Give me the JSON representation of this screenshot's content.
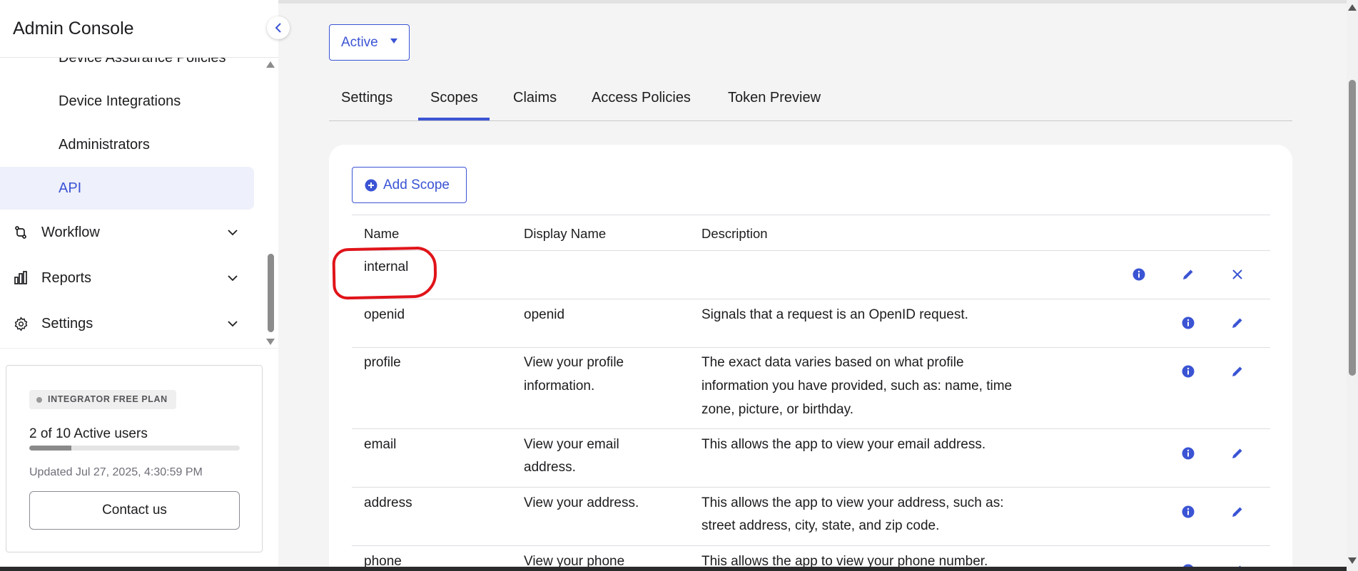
{
  "app": {
    "title": "Admin Console"
  },
  "sidebar": {
    "sub_items": [
      {
        "label": "Device Assurance Policies",
        "active": false
      },
      {
        "label": "Device Integrations",
        "active": false
      },
      {
        "label": "Administrators",
        "active": false
      },
      {
        "label": "API",
        "active": true
      }
    ],
    "groups": [
      {
        "label": "Workflow",
        "icon": "workflow-icon"
      },
      {
        "label": "Reports",
        "icon": "reports-icon"
      },
      {
        "label": "Settings",
        "icon": "settings-gear-icon"
      }
    ]
  },
  "plan": {
    "badge": "INTEGRATOR FREE PLAN",
    "users_text": "2 of 10 Active users",
    "users_used": 2,
    "users_total": 10,
    "updated": "Updated Jul 27, 2025, 4:30:59 PM",
    "contact_label": "Contact us"
  },
  "main": {
    "status": "Active",
    "tabs": [
      {
        "label": "Settings",
        "active": false
      },
      {
        "label": "Scopes",
        "active": true
      },
      {
        "label": "Claims",
        "active": false
      },
      {
        "label": "Access Policies",
        "active": false
      },
      {
        "label": "Token Preview",
        "active": false
      }
    ],
    "add_scope_label": "Add Scope",
    "columns": {
      "name": "Name",
      "display_name": "Display Name",
      "description": "Description"
    },
    "rows": [
      {
        "name": "internal",
        "display_name": "",
        "description": [],
        "actions": [
          "info",
          "edit",
          "delete"
        ]
      },
      {
        "name": "openid",
        "display_name": "openid",
        "description": [
          "Signals that a request is an OpenID request."
        ],
        "actions": [
          "info",
          "edit"
        ]
      },
      {
        "name": "profile",
        "display_name": [
          "View your profile",
          "information."
        ],
        "description": [
          "The exact data varies based on what profile",
          "information you have provided, such as: name, time",
          "zone, picture, or birthday."
        ],
        "actions": [
          "info",
          "edit"
        ]
      },
      {
        "name": "email",
        "display_name": [
          "View your email",
          "address."
        ],
        "description": [
          "This allows the app to view your email address."
        ],
        "actions": [
          "info",
          "edit"
        ]
      },
      {
        "name": "address",
        "display_name": [
          "View your address."
        ],
        "description": [
          "This allows the app to view your address, such as:",
          "street address, city, state, and zip code."
        ],
        "actions": [
          "info",
          "edit"
        ]
      },
      {
        "name": "phone",
        "display_name": [
          "View your phone"
        ],
        "description": [
          "This allows the app to view your phone number."
        ],
        "actions": [
          "info",
          "edit"
        ]
      }
    ]
  },
  "colors": {
    "accent": "#3b54d4",
    "highlight": "#e0141a",
    "active_bg": "#eef0fb"
  }
}
